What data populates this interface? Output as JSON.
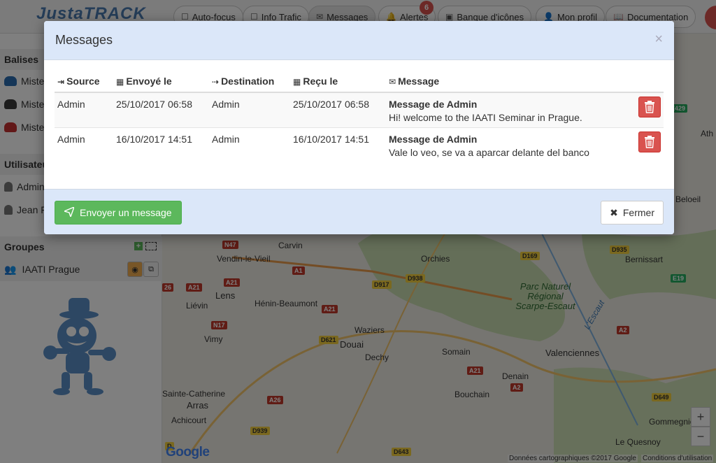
{
  "app": {
    "logo": "JustaTRACK"
  },
  "navbar": {
    "items": [
      {
        "label": "Auto-focus",
        "icon": "square-icon"
      },
      {
        "label": "Info Trafic",
        "icon": "square-icon"
      },
      {
        "label": "Messages",
        "icon": "envelope-icon"
      },
      {
        "label": "Alertes",
        "icon": "bell-icon",
        "badge": "6"
      },
      {
        "label": "Banque d'icônes",
        "icon": "image-icon"
      },
      {
        "label": "Mon profil",
        "icon": "user-icon"
      },
      {
        "label": "Documentation",
        "icon": "book-icon"
      }
    ]
  },
  "sidebar": {
    "balises_title": "Balises",
    "balises": [
      {
        "label": "Mister"
      },
      {
        "label": "Mister"
      },
      {
        "label": "Mister"
      }
    ],
    "users_title": "Utilisateurs",
    "users": [
      {
        "label": "Admin"
      },
      {
        "label": "Jean F"
      }
    ],
    "groups_title": "Groupes",
    "groups": [
      {
        "label": "IAATI Prague"
      }
    ]
  },
  "map": {
    "labels": {
      "carvin": "Carvin",
      "vendin": "Vendin-le-Vieil",
      "lens": "Lens",
      "lievin": "Liévin",
      "henin": "Hénin-Beaumont",
      "waziers": "Waziers",
      "douai": "Douai",
      "dechy": "Dechy",
      "somain": "Somain",
      "valenciennes": "Valenciennes",
      "denain": "Denain",
      "bouchain": "Bouchain",
      "arras": "Arras",
      "achicourt": "Achicourt",
      "sainte_catherine": "Sainte-Catherine",
      "vimy": "Vimy",
      "orchies": "Orchies",
      "bernissart": "Bernissart",
      "beloeil": "Beloeil",
      "gommegnies": "Gommegnies",
      "le_quesnoy": "Le Quesnoy",
      "park": "Parc Naturel Régional Scarpe-Escaut",
      "escaut": "L'Escaut",
      "ath": "Ath"
    },
    "attribution": "Données cartographiques ©2017 Google",
    "terms": "Conditions d'utilisation",
    "zoom_in": "+",
    "zoom_out": "−"
  },
  "modal": {
    "title": "Messages",
    "close_symbol": "×",
    "columns": {
      "source": "Source",
      "sent": "Envoyé le",
      "destination": "Destination",
      "received": "Reçu le",
      "message": "Message"
    },
    "rows": [
      {
        "source": "Admin",
        "sent": "25/10/2017 06:58",
        "destination": "Admin",
        "received": "25/10/2017 06:58",
        "title": "Message de Admin",
        "body": "Hi! welcome to the IAATI Seminar in Prague."
      },
      {
        "source": "Admin",
        "sent": "16/10/2017 14:51",
        "destination": "Admin",
        "received": "16/10/2017 14:51",
        "title": "Message de Admin",
        "body": "Vale lo veo, se va a aparcar delante del banco"
      }
    ],
    "send_label": "Envoyer un message",
    "close_label": "Fermer"
  },
  "colors": {
    "modal_header_bg": "#dbe7f9",
    "success": "#5cb85c",
    "danger": "#d9534f"
  }
}
